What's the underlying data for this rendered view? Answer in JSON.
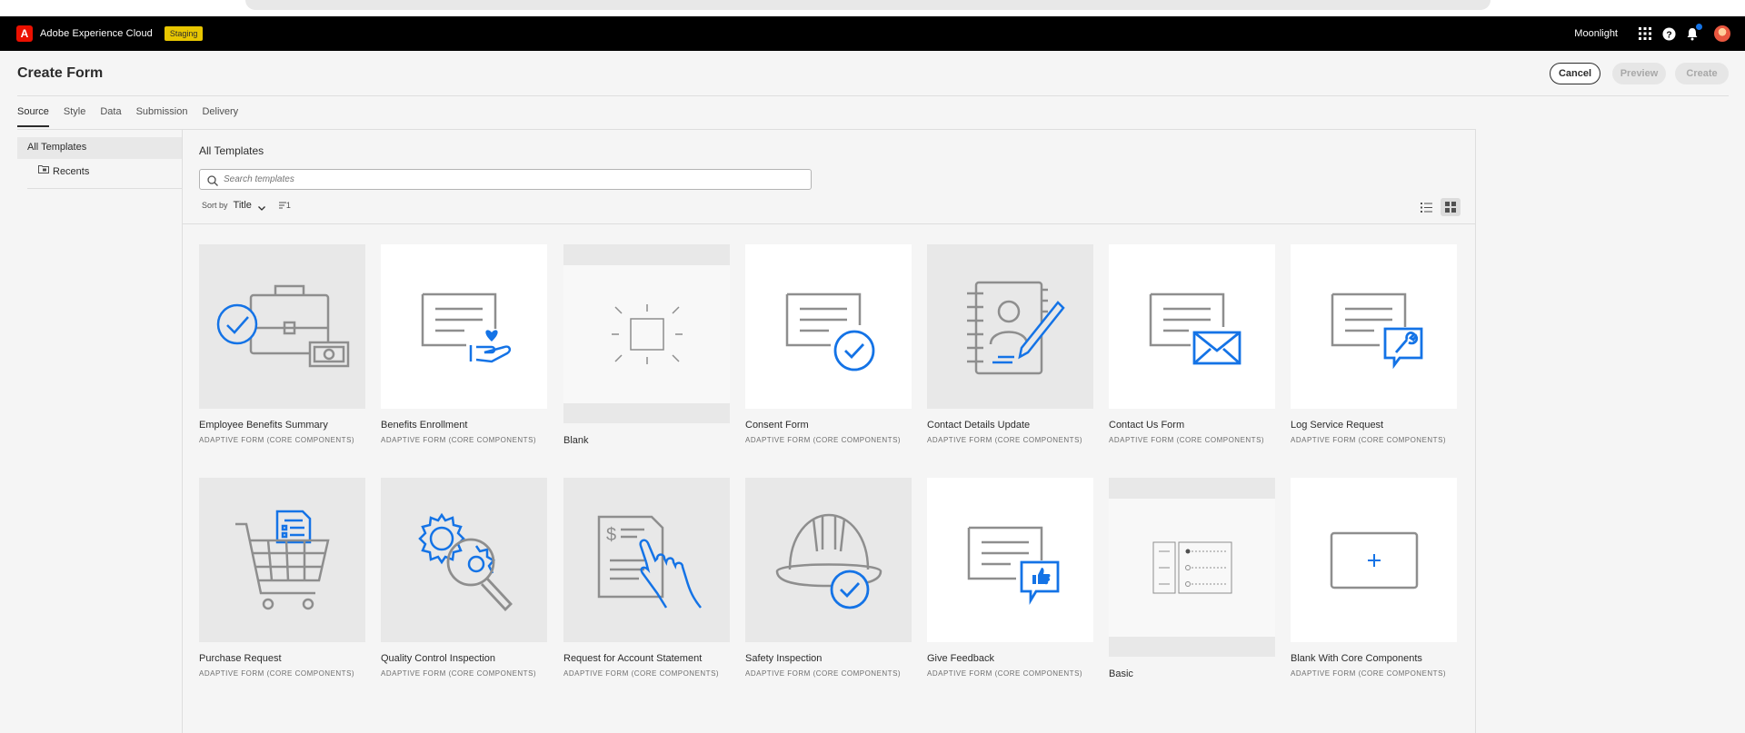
{
  "topbar": {
    "logo_letter": "A",
    "brand": "Adobe Experience Cloud",
    "env_badge": "Staging",
    "org_name": "Moonlight",
    "icons": [
      "apps-grid-icon",
      "help-icon",
      "bell-icon",
      "avatar"
    ]
  },
  "header": {
    "title": "Create Form",
    "cancel_label": "Cancel",
    "preview_label": "Preview",
    "create_label": "Create"
  },
  "tabs": [
    {
      "label": "Source",
      "active": true
    },
    {
      "label": "Style",
      "active": false
    },
    {
      "label": "Data",
      "active": false
    },
    {
      "label": "Submission",
      "active": false
    },
    {
      "label": "Delivery",
      "active": false
    }
  ],
  "sidebar": {
    "items": [
      {
        "label": "All Templates",
        "selected": true
      },
      {
        "label": "Recents",
        "selected": false,
        "icon": "folder-icon"
      }
    ]
  },
  "main": {
    "title": "All Templates",
    "search_placeholder": "Search templates",
    "sort_label": "Sort by",
    "sort_value": "Title",
    "sort_order": "1"
  },
  "templates": [
    {
      "title": "Employee Benefits Summary",
      "subtitle": "ADAPTIVE FORM (CORE COMPONENTS)",
      "icon": "briefcase-check-icon"
    },
    {
      "title": "Benefits Enrollment",
      "subtitle": "ADAPTIVE FORM (CORE COMPONENTS)",
      "icon": "form-heart-hand-icon"
    },
    {
      "title": "Blank",
      "subtitle": "",
      "icon": "blank-sparkle-icon"
    },
    {
      "title": "Consent Form",
      "subtitle": "ADAPTIVE FORM (CORE COMPONENTS)",
      "icon": "form-check-icon"
    },
    {
      "title": "Contact Details Update",
      "subtitle": "ADAPTIVE FORM (CORE COMPONENTS)",
      "icon": "address-book-pen-icon"
    },
    {
      "title": "Contact Us Form",
      "subtitle": "ADAPTIVE FORM (CORE COMPONENTS)",
      "icon": "form-envelope-icon"
    },
    {
      "title": "Log Service Request",
      "subtitle": "ADAPTIVE FORM (CORE COMPONENTS)",
      "icon": "form-wrench-icon"
    },
    {
      "title": "Purchase Request",
      "subtitle": "ADAPTIVE FORM (CORE COMPONENTS)",
      "icon": "cart-document-icon"
    },
    {
      "title": "Quality Control Inspection",
      "subtitle": "ADAPTIVE FORM (CORE COMPONENTS)",
      "icon": "gear-magnifier-icon"
    },
    {
      "title": "Request for Account Statement",
      "subtitle": "ADAPTIVE FORM (CORE COMPONENTS)",
      "icon": "document-hand-icon"
    },
    {
      "title": "Safety Inspection",
      "subtitle": "ADAPTIVE FORM (CORE COMPONENTS)",
      "icon": "hardhat-check-icon"
    },
    {
      "title": "Give Feedback",
      "subtitle": "ADAPTIVE FORM (CORE COMPONENTS)",
      "icon": "form-thumbsup-icon"
    },
    {
      "title": "Basic",
      "subtitle": "",
      "icon": "basic-form-icon"
    },
    {
      "title": "Blank With Core Components",
      "subtitle": "ADAPTIVE FORM (CORE COMPONENTS)",
      "icon": "blank-plus-icon"
    }
  ],
  "colors": {
    "accent_blue": "#1473e6",
    "icon_gray": "#8e8e8e",
    "topbar_bg": "#000000",
    "badge_yellow": "#e8c600"
  }
}
